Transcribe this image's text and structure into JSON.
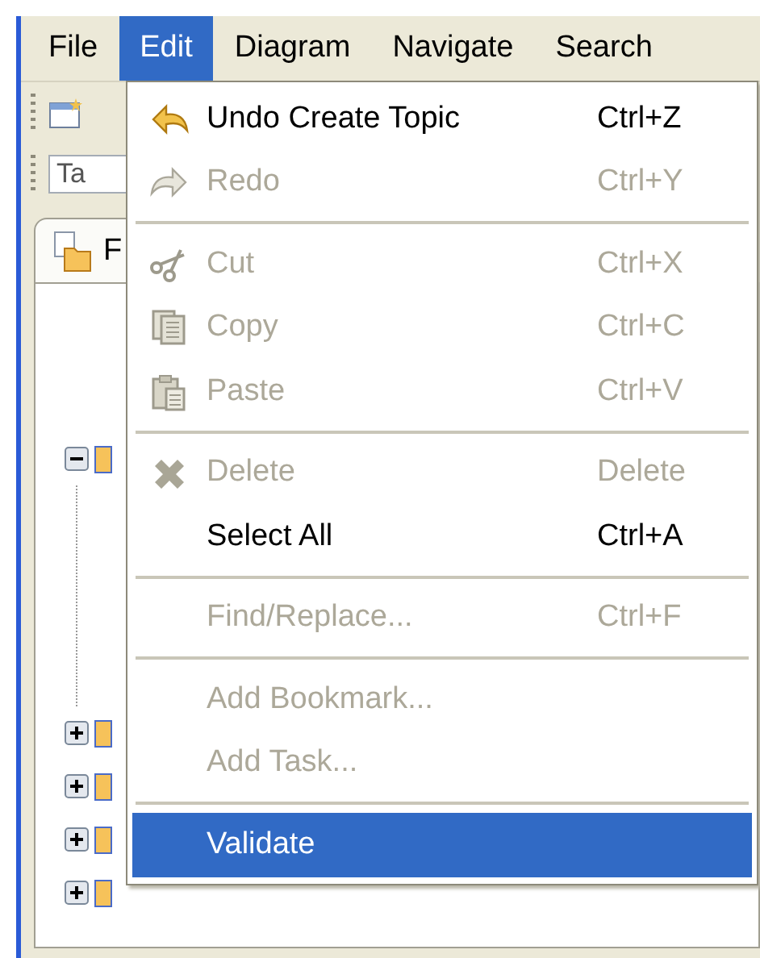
{
  "menu_bar": [
    {
      "label": "File",
      "selected": false
    },
    {
      "label": "Edit",
      "selected": true
    },
    {
      "label": "Diagram",
      "selected": false
    },
    {
      "label": "Navigate",
      "selected": false
    },
    {
      "label": "Search",
      "selected": false
    }
  ],
  "side_panel": {
    "filter_field": {
      "value": "Ta"
    },
    "tab": {
      "label": "F"
    },
    "tree": [
      {
        "expanded": true
      },
      {
        "expanded": false
      },
      {
        "expanded": false
      },
      {
        "expanded": false
      },
      {
        "expanded": false
      }
    ]
  },
  "edit_menu": [
    {
      "kind": "item",
      "label": "Undo Create Topic",
      "shortcut": "Ctrl+Z",
      "disabled": false,
      "selected": false
    },
    {
      "kind": "item",
      "label": "Redo",
      "shortcut": "Ctrl+Y",
      "disabled": true,
      "selected": false
    },
    {
      "kind": "separator"
    },
    {
      "kind": "item",
      "label": "Cut",
      "shortcut": "Ctrl+X",
      "disabled": true,
      "selected": false
    },
    {
      "kind": "item",
      "label": "Copy",
      "shortcut": "Ctrl+C",
      "disabled": true,
      "selected": false
    },
    {
      "kind": "item",
      "label": "Paste",
      "shortcut": "Ctrl+V",
      "disabled": true,
      "selected": false
    },
    {
      "kind": "separator"
    },
    {
      "kind": "item",
      "label": "Delete",
      "shortcut": "Delete",
      "disabled": true,
      "selected": false
    },
    {
      "kind": "item",
      "label": "Select All",
      "shortcut": "Ctrl+A",
      "disabled": false,
      "selected": false
    },
    {
      "kind": "separator"
    },
    {
      "kind": "item",
      "label": "Find/Replace...",
      "shortcut": "Ctrl+F",
      "disabled": true,
      "selected": false
    },
    {
      "kind": "separator"
    },
    {
      "kind": "item",
      "label": "Add Bookmark...",
      "disabled": true,
      "selected": false
    },
    {
      "kind": "item",
      "label": "Add Task...",
      "disabled": true,
      "selected": false
    },
    {
      "kind": "separator"
    },
    {
      "kind": "item",
      "label": "Validate",
      "disabled": false,
      "selected": true
    }
  ]
}
